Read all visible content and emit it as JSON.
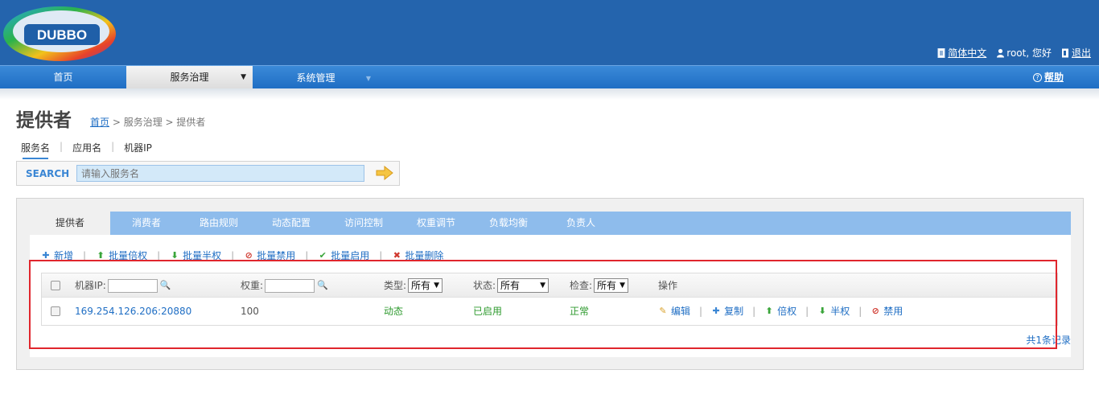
{
  "logo": {
    "text": "DUBBO"
  },
  "header": {
    "lang_label": "简体中文",
    "user_label": "root, 您好",
    "logout_label": "退出"
  },
  "nav": {
    "home": "首页",
    "service_gov": "服务治理",
    "system": "系统管理",
    "help": "帮助"
  },
  "page": {
    "title": "提供者",
    "breadcrumb": {
      "home": "首页",
      "rest": " > 服务治理 > 提供者"
    }
  },
  "search": {
    "tabs": [
      "服务名",
      "应用名",
      "机器IP"
    ],
    "label": "SEARCH",
    "placeholder": "请输入服务名"
  },
  "tabs": [
    "提供者",
    "消费者",
    "路由规则",
    "动态配置",
    "访问控制",
    "权重调节",
    "负载均衡",
    "负责人"
  ],
  "toolbar": {
    "add": "新增",
    "batch_double": "批量倍权",
    "batch_half": "批量半权",
    "batch_disable": "批量禁用",
    "batch_enable": "批量启用",
    "batch_delete": "批量删除"
  },
  "table": {
    "headers": {
      "ip": "机器IP:",
      "weight": "权重:",
      "type": "类型:",
      "status": "状态:",
      "check": "检查:",
      "ops": "操作"
    },
    "filters": {
      "type": "所有",
      "status": "所有",
      "check": "所有"
    },
    "rows": [
      {
        "address": "169.254.126.206:20880",
        "weight": "100",
        "type": "动态",
        "status": "已启用",
        "check": "正常",
        "ops": [
          "编辑",
          "复制",
          "倍权",
          "半权",
          "禁用"
        ]
      }
    ],
    "total": "共1条记录"
  },
  "colors": {
    "header_bg": "#2464ad",
    "nav_bg": "#1f6ec4",
    "tab_bar": "#8ebcec",
    "link": "#1f6ec4",
    "highlight_border": "#e0262d"
  }
}
